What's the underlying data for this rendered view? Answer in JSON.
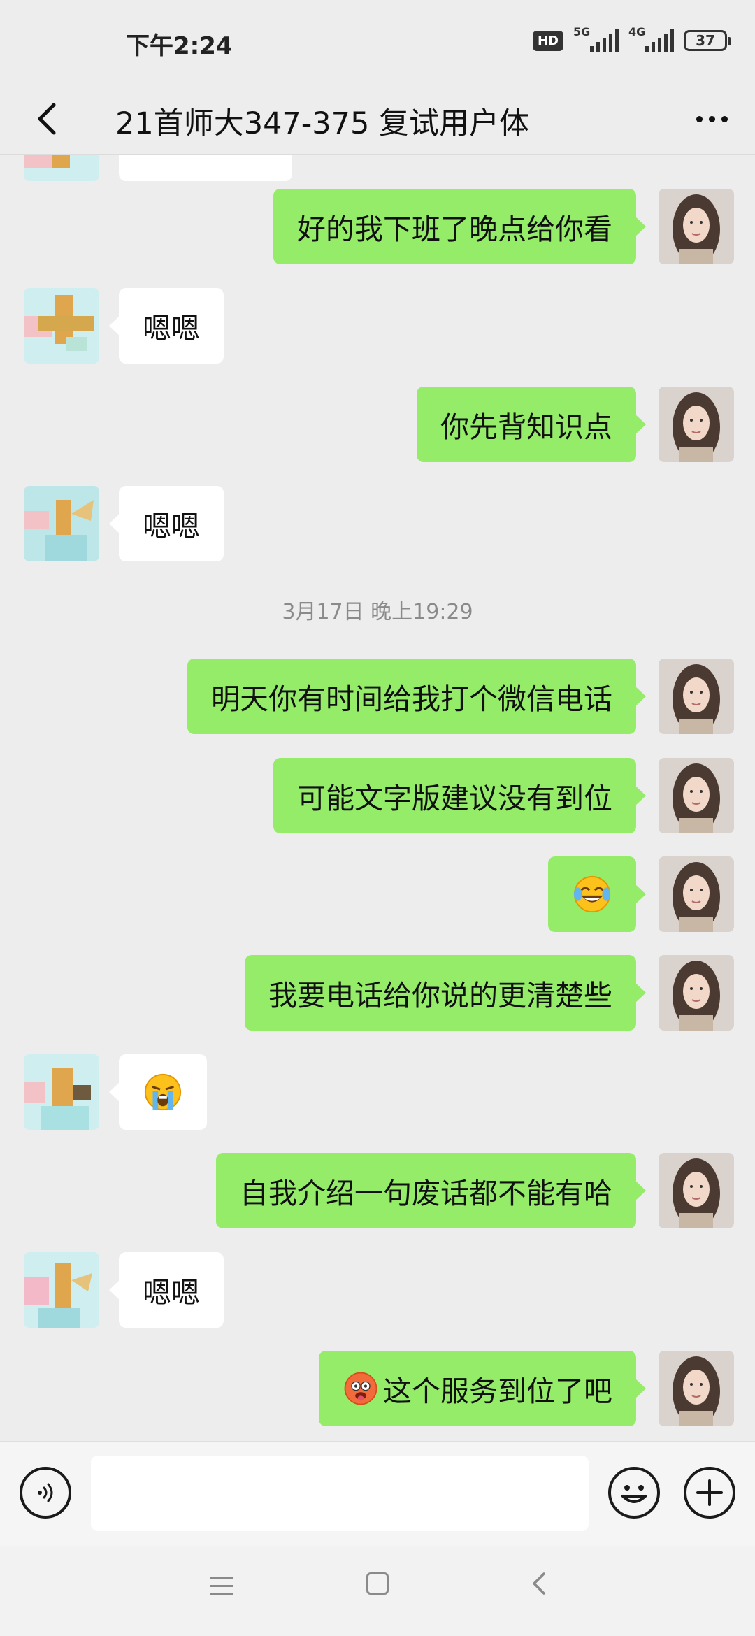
{
  "status_bar": {
    "time": "下午2:24",
    "hd": "HD",
    "net1": "5G",
    "net2": "4G",
    "battery": "37"
  },
  "header": {
    "title": "21首师大347-375 复试用户体"
  },
  "timestamp": "3月17日 晚上19:29",
  "messages": [
    {
      "side": "right",
      "text": "好的我下班了晚点给你看"
    },
    {
      "side": "left",
      "text": "嗯嗯"
    },
    {
      "side": "right",
      "text": "你先背知识点"
    },
    {
      "side": "left",
      "text": "嗯嗯"
    },
    {
      "side": "right",
      "text": "明天你有时间给我打个微信电话"
    },
    {
      "side": "right",
      "text": "可能文字版建议没有到位"
    },
    {
      "side": "right",
      "text": "",
      "emoji": "laughing-crying-emoji"
    },
    {
      "side": "right",
      "text": "我要电话给你说的更清楚些"
    },
    {
      "side": "left",
      "text": "",
      "emoji": "loudly-crying-emoji"
    },
    {
      "side": "right",
      "text": "自我介绍一句废话都不能有哈"
    },
    {
      "side": "left",
      "text": "嗯嗯"
    },
    {
      "side": "right",
      "text": "这个服务到位了吧",
      "emoji": "hot-face-emoji"
    }
  ],
  "input": {
    "value": "",
    "placeholder": ""
  },
  "icons": {
    "back": "back-icon",
    "more": "more-icon",
    "voice": "voice-icon",
    "emoji": "smiley-icon",
    "plus": "plus-icon"
  },
  "colors": {
    "background": "#ededed",
    "sent_bubble": "#95ec69",
    "received_bubble": "#ffffff"
  }
}
